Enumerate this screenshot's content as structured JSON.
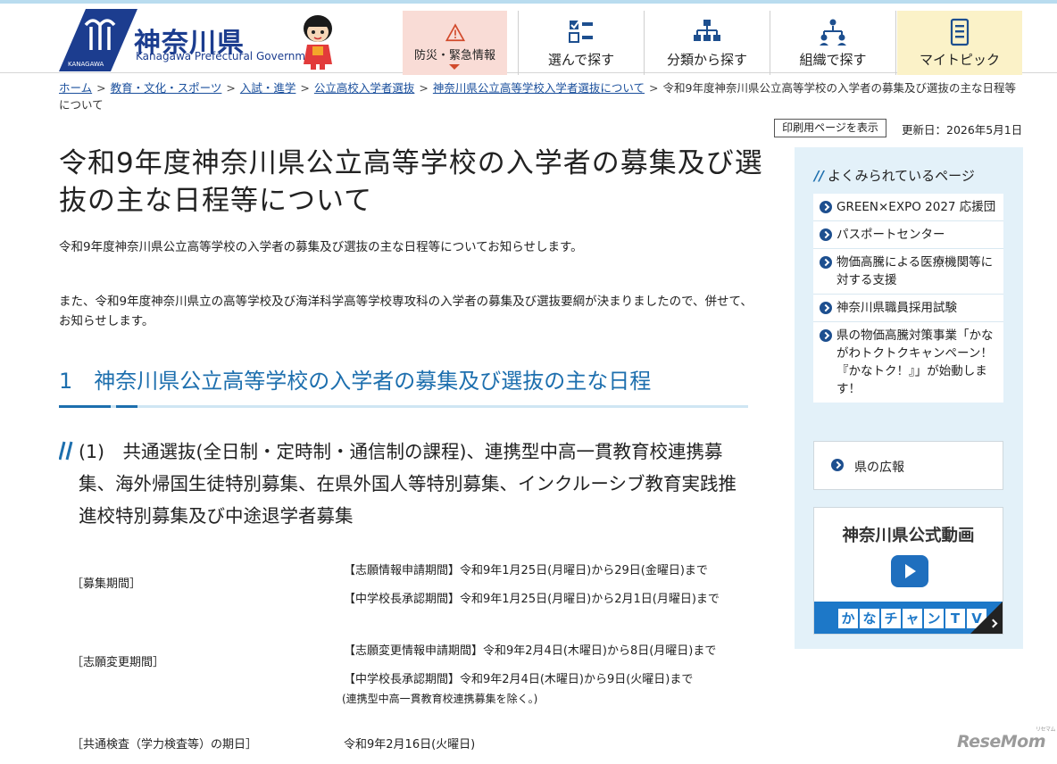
{
  "header": {
    "logo_jp": "神奈川県",
    "logo_en": "Kanagawa Prefectural Government",
    "logo_mark_text": "KANAGAWA",
    "nav": [
      {
        "label": "防災・緊急情報",
        "icon": "warning-icon"
      },
      {
        "label": "選んで探す",
        "icon": "checklist-icon"
      },
      {
        "label": "分類から探す",
        "icon": "category-tree-icon"
      },
      {
        "label": "組織で探す",
        "icon": "organization-icon"
      },
      {
        "label": "マイトピック",
        "icon": "bookmark-list-icon"
      }
    ]
  },
  "breadcrumb": {
    "links": [
      "ホーム",
      "教育・文化・スポーツ",
      "入試・進学",
      "公立高校入学者選抜",
      "神奈川県公立高等学校入学者選抜について"
    ],
    "current": "令和9年度神奈川県公立高等学校の入学者の募集及び選抜の主な日程等について"
  },
  "util": {
    "print_label": "印刷用ページを表示",
    "updated": "更新日：2026年5月1日"
  },
  "main": {
    "title": "令和9年度神奈川県公立高等学校の入学者の募集及び選抜の主な日程等について",
    "lead1": "令和9年度神奈川県公立高等学校の入学者の募集及び選抜の主な日程等についてお知らせします。",
    "lead2": "また、令和9年度神奈川県立の高等学校及び海洋科学高等学校専攻科の入学者の募集及び選抜要綱が決まりましたので、併せて、お知らせします。",
    "h2": "1　神奈川県公立高等学校の入学者の募集及び選抜の主な日程",
    "h3": "(1)　共通選抜(全日制・定時制・通信制の課程)、連携型中高一貫教育校連携募集、海外帰国生徒特別募集、在県外国人等特別募集、インクルーシブ教育実践推進校特別募集及び中途退学者募集",
    "schedule": [
      {
        "label": "［募集期間］",
        "lines": [
          "【志願情報申請期間】令和9年1月25日(月曜日)から29日(金曜日)まで",
          "【中学校長承認期間】令和9年1月25日(月曜日)から2月1日(月曜日)まで"
        ]
      },
      {
        "label": "［志願変更期間］",
        "lines": [
          "【志願変更情報申請期間】令和9年2月4日(木曜日)から8日(月曜日)まで",
          "【中学校長承認期間】令和9年2月4日(木曜日)から9日(火曜日)まで"
        ],
        "note": "(連携型中高一貫教育校連携募集を除く。)"
      },
      {
        "label": "［共通検査（学力検査等）の期日］",
        "lines": [
          "令和9年2月16日(火曜日)"
        ]
      }
    ]
  },
  "sidebar": {
    "popular_title": "よくみられているページ",
    "popular": [
      "GREEN×EXPO 2027 応援団",
      "パスポートセンター",
      "物価高騰による医療機関等に対する支援",
      "神奈川県職員採用試験",
      "県の物価高騰対策事業「かながわトクトクキャンペーン！『かなトク！』」が始動します！"
    ],
    "koho": "県の広報",
    "video_title": "神奈川県公式動画",
    "video_band": [
      "か",
      "な",
      "チ",
      "ャ",
      "ン",
      "T",
      "V"
    ]
  },
  "watermark": {
    "text": "ReseMom",
    "sub": "リセマム"
  },
  "colors": {
    "accent_blue": "#1d6fae",
    "logo_navy": "#1c3d8f",
    "disaster_bg": "#f9dcd6",
    "mytopic_bg": "#fbf2c8",
    "sidebar_bg": "#e3f1f9"
  }
}
